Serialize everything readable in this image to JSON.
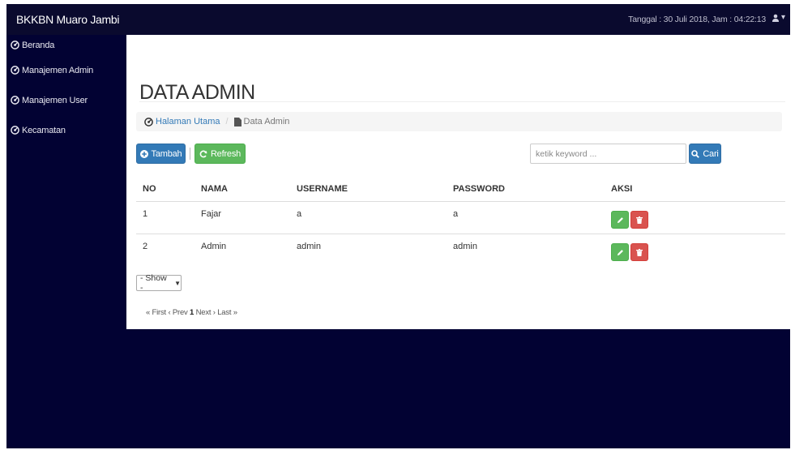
{
  "app": {
    "brand": "BKKBN Muaro Jambi",
    "datetime": "Tanggal : 30 Juli 2018, Jam : 04:22:13"
  },
  "icons": {
    "nav": "dashboard-icon",
    "user": "user-icon",
    "file": "file-icon",
    "add": "plus-circle-icon",
    "refresh": "refresh-icon",
    "search": "search-icon",
    "edit": "pencil-icon",
    "delete": "trash-icon"
  },
  "colors": {
    "navbar": "#0a0a2e",
    "background": "#020233",
    "primary": "#337ab7",
    "success": "#5cb85c",
    "danger": "#d9534f"
  },
  "sidebar": {
    "items": [
      {
        "label": "Beranda"
      },
      {
        "label": "Manajemen Admin"
      },
      {
        "label": "Manajemen User"
      },
      {
        "label": "Kecamatan"
      }
    ]
  },
  "page": {
    "title": "DATA ADMIN"
  },
  "breadcrumb": {
    "home": "Halaman Utama",
    "current": "Data Admin",
    "separator": "/"
  },
  "toolbar": {
    "add_label": "Tambah",
    "refresh_label": "Refresh",
    "search_placeholder": "ketik keyword ...",
    "search_label": "Cari"
  },
  "table": {
    "headers": [
      "NO",
      "NAMA",
      "USERNAME",
      "PASSWORD",
      "AKSI"
    ],
    "rows": [
      {
        "no": "1",
        "nama": "Fajar",
        "username": "a",
        "password": "a"
      },
      {
        "no": "2",
        "nama": "Admin",
        "username": "admin",
        "password": "admin"
      }
    ]
  },
  "pagination": {
    "show_label": "- Show -",
    "first": "« First",
    "prev": "‹ Prev",
    "current": "1",
    "next": "Next ›",
    "last": "Last »"
  }
}
